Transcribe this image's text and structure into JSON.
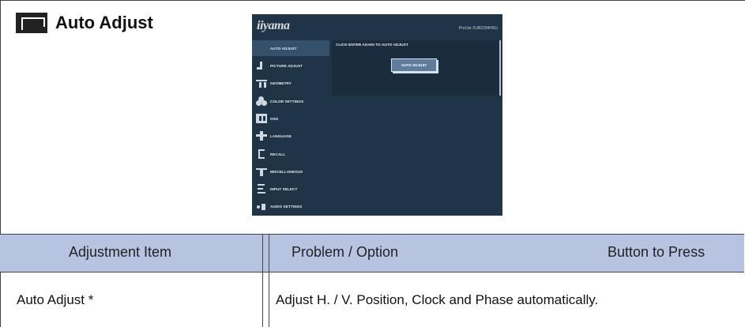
{
  "section": {
    "title": "Auto Adjust"
  },
  "osd": {
    "logo": "iiyama",
    "model": "ProLite XUB2294HSU",
    "hint": "CLICK ENTER AGAIN TO AUTO ADJUST",
    "button": "AUTO ADJUST",
    "menu": [
      {
        "label": "AUTO ADJUST",
        "icon": "auto-adjust-icon"
      },
      {
        "label": "PICTURE ADJUST",
        "icon": "picture-adjust-icon"
      },
      {
        "label": "GEOMETRY",
        "icon": "geometry-icon"
      },
      {
        "label": "COLOR SETTINGS",
        "icon": "color-settings-icon"
      },
      {
        "label": "OSD",
        "icon": "osd-icon"
      },
      {
        "label": "LANGUAGE",
        "icon": "language-icon"
      },
      {
        "label": "RECALL",
        "icon": "recall-icon"
      },
      {
        "label": "MISCELLANEOUS",
        "icon": "miscellaneous-icon"
      },
      {
        "label": "INPUT SELECT",
        "icon": "input-select-icon"
      },
      {
        "label": "AUDIO SETTINGS",
        "icon": "audio-settings-icon"
      }
    ]
  },
  "table": {
    "headers": {
      "item": "Adjustment Item",
      "problem": "Problem / Option",
      "button": "Button to Press"
    },
    "rows": [
      {
        "item": "Auto Adjust *",
        "problem": "Adjust H. / V. Position, Clock and Phase automatically."
      }
    ]
  },
  "colors": {
    "header_bg": "#b7c4e1",
    "osd_bg": "#203448",
    "osd_active": "#34506a",
    "osd_button": "#5e7d9d"
  }
}
